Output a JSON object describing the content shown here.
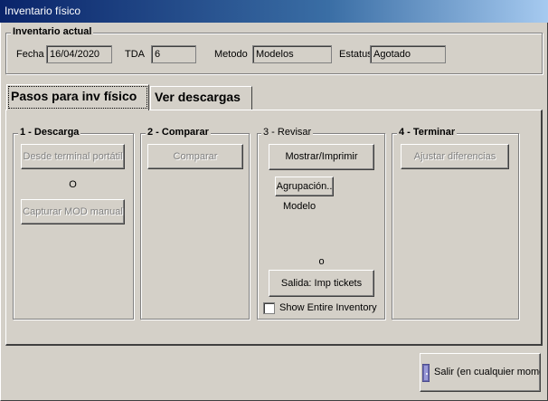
{
  "window": {
    "title": "Inventario físico"
  },
  "current_inventory": {
    "group_label": "Inventario actual",
    "fecha_label": "Fecha",
    "fecha_value": "16/04/2020",
    "tda_label": "TDA",
    "tda_value": "6",
    "metodo_label": "Metodo",
    "metodo_value": "Modelos",
    "estatus_label": "Estatus",
    "estatus_value": "Agotado"
  },
  "tabs": [
    {
      "label": "Pasos para inv físico",
      "active": true
    },
    {
      "label": "Ver descargas",
      "active": false
    }
  ],
  "steps": {
    "descarga": {
      "title": "1 - Descarga",
      "btn_terminal": "Desde terminal portátil",
      "or_text": "O",
      "btn_manual": "Capturar MOD manual"
    },
    "comparar": {
      "title": "2 - Comparar",
      "btn_comparar": "Comparar"
    },
    "revisar": {
      "title": "3 - Revisar",
      "btn_mostrar": "Mostrar/Imprimir",
      "btn_agrupacion": "Agrupación..",
      "agrupacion_value": "Modelo",
      "or_text": "o",
      "btn_salida": "Salida: Imp tickets",
      "show_entire_label": "Show Entire Inventory",
      "show_entire_checked": false
    },
    "terminar": {
      "title": "4 - Terminar",
      "btn_ajustar": "Ajustar diferencias"
    }
  },
  "footer": {
    "exit_label": "Salir (en cualquier momento)",
    "exit_icon": "door-exit-icon"
  }
}
